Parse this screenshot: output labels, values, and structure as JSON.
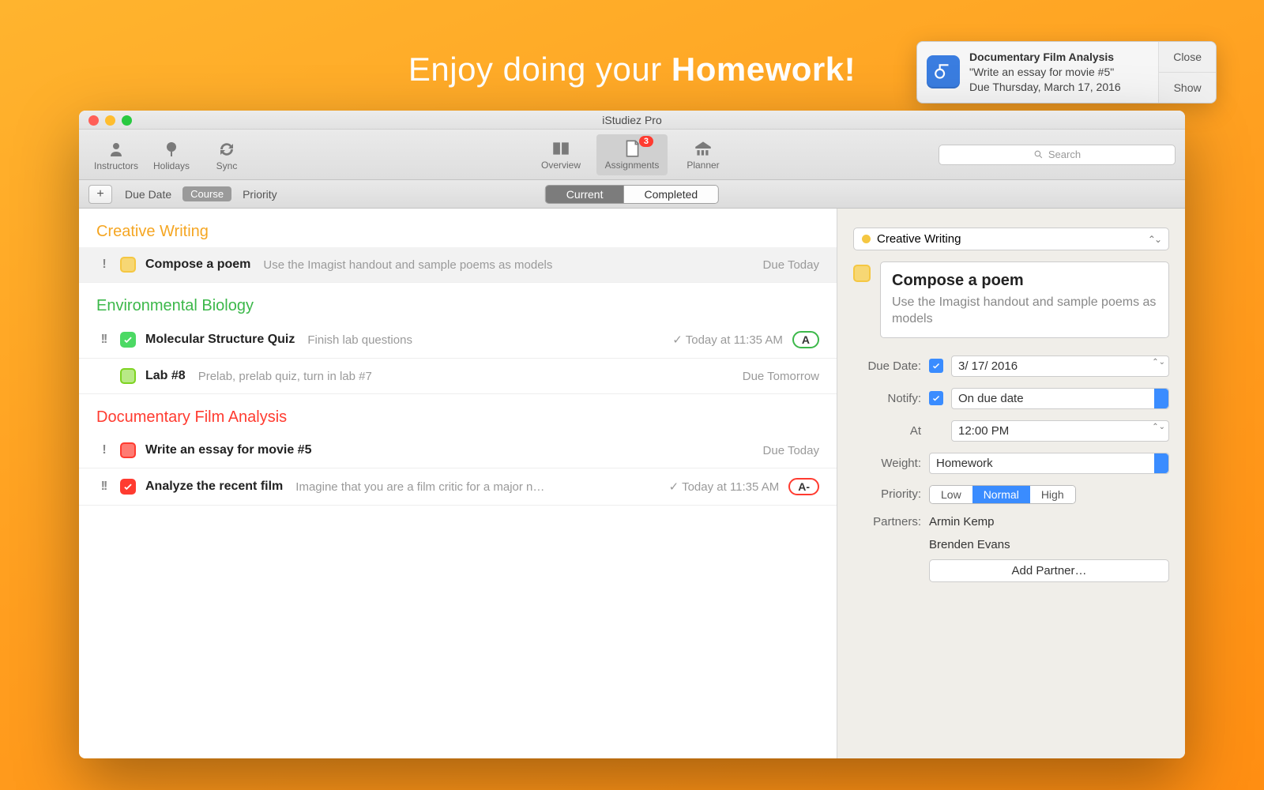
{
  "tagline_a": "Enjoy doing your ",
  "tagline_b": "Homework!",
  "notification": {
    "title": "Documentary Film Analysis",
    "body": "\"Write an essay for movie #5\"",
    "due": "Due Thursday, March 17, 2016",
    "close": "Close",
    "show": "Show"
  },
  "window": {
    "title": "iStudiez Pro",
    "toolbar": {
      "instructors": "Instructors",
      "holidays": "Holidays",
      "sync": "Sync",
      "overview": "Overview",
      "assignments": "Assignments",
      "assignments_badge": "3",
      "planner": "Planner",
      "search_placeholder": "Search"
    },
    "subbar": {
      "add": "+",
      "sort_due": "Due Date",
      "sort_course": "Course",
      "sort_priority": "Priority",
      "seg_current": "Current",
      "seg_completed": "Completed"
    }
  },
  "groups": {
    "cw": "Creative Writing",
    "eb": "Environmental Biology",
    "df": "Documentary Film Analysis"
  },
  "rows": {
    "r1": {
      "pri": "!",
      "title": "Compose a poem",
      "desc": "Use the Imagist handout and sample poems as models",
      "due": "Due Today"
    },
    "r2": {
      "pri": "!!",
      "title": "Molecular Structure Quiz",
      "desc": "Finish lab questions",
      "due": "✓ Today at 11:35 AM",
      "grade": "A"
    },
    "r3": {
      "pri": "",
      "title": "Lab #8",
      "desc": "Prelab, prelab quiz, turn in lab #7",
      "due": "Due Tomorrow"
    },
    "r4": {
      "pri": "!",
      "title": "Write an essay for movie #5",
      "desc": "",
      "due": "Due Today"
    },
    "r5": {
      "pri": "!!",
      "title": "Analyze the recent film",
      "desc": "Imagine that you are a film critic for a major n…",
      "due": "✓ Today at 11:35 AM",
      "grade": "A-"
    }
  },
  "detail": {
    "course": "Creative Writing",
    "title": "Compose a poem",
    "desc": "Use the Imagist handout and sample poems as models",
    "labels": {
      "due": "Due Date:",
      "notify": "Notify:",
      "at": "At",
      "weight": "Weight:",
      "priority": "Priority:",
      "partners": "Partners:"
    },
    "due_value": "3/ 17/ 2016",
    "notify_value": "On due date",
    "at_value": "12:00 PM",
    "weight_value": "Homework",
    "priority": {
      "low": "Low",
      "normal": "Normal",
      "high": "High"
    },
    "partner1": "Armin Kemp",
    "partner2": "Brenden Evans",
    "add_partner": "Add Partner…"
  }
}
